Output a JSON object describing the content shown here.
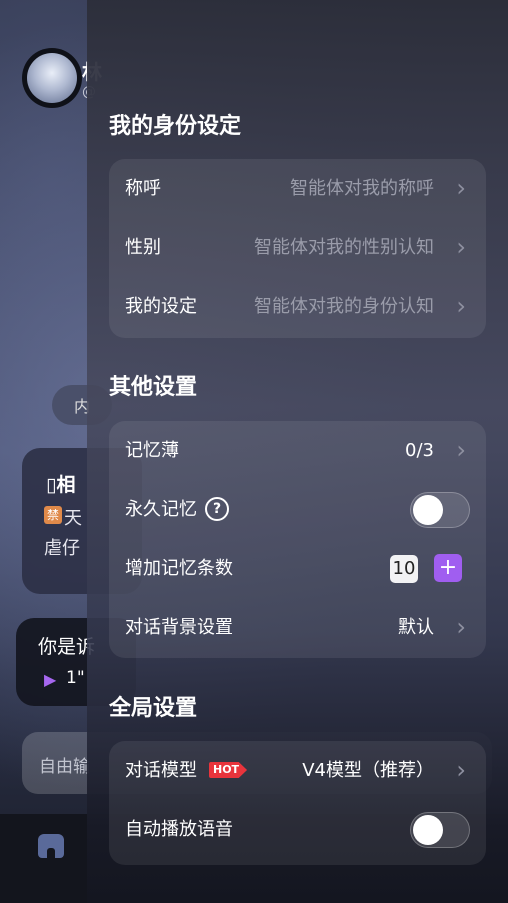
{
  "background_chat": {
    "header_name": "林",
    "header_sub": "@",
    "pill_text": "内",
    "card1_title": "相",
    "card1_badge": "禁",
    "card1_line1": "天",
    "card1_line2": "虐仔",
    "card2_text": "你是诉",
    "card2_voice": "1\"",
    "input_placeholder": "自由输"
  },
  "drawer": {
    "identity": {
      "title": "我的身份设定",
      "rows": [
        {
          "label": "称呼",
          "hint": "智能体对我的称呼"
        },
        {
          "label": "性别",
          "hint": "智能体对我的性别认知"
        },
        {
          "label": "我的设定",
          "hint": "智能体对我的身份认知"
        }
      ]
    },
    "other": {
      "title": "其他设置",
      "memory_book": {
        "label": "记忆薄",
        "value": "0/3"
      },
      "permanent_memory": {
        "label": "永久记忆",
        "help_icon": "?",
        "toggle_on": false
      },
      "add_memory": {
        "label": "增加记忆条数",
        "count": "10",
        "plus": "+"
      },
      "chat_background": {
        "label": "对话背景设置",
        "value": "默认"
      }
    },
    "global": {
      "title": "全局设置",
      "model": {
        "label": "对话模型",
        "badge": "HOT",
        "value": "V4模型（推荐）"
      },
      "autoplay": {
        "label": "自动播放语音",
        "toggle_on": false
      }
    }
  },
  "chevron": "›",
  "colors": {
    "accent_purple": "#a05ef0",
    "hot_red": "#e8343c"
  }
}
